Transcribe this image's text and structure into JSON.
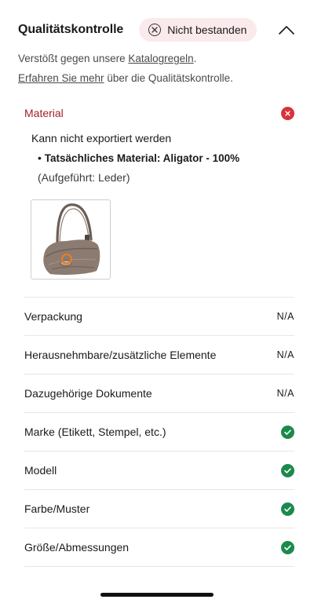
{
  "header": {
    "title": "Qualitätskontrolle",
    "status_label": "Nicht bestanden",
    "status_icon": "x-circle-icon",
    "collapse_icon": "chevron-up-icon"
  },
  "intro": {
    "line1_prefix": "Verstößt gegen unsere ",
    "catalog_link": "Katalogregeln",
    "line1_suffix": ".",
    "learn_more_link": "Erfahren Sie mehr",
    "line2_suffix": " über die Qualitätskontrolle."
  },
  "material": {
    "title": "Material",
    "status_icon": "error-icon",
    "message": "Kann nicht exportiert werden",
    "bullet": "• ",
    "actual": "Tatsächliches Material: Aligator - 100%",
    "listed": "(Aufgeführt: Leder)",
    "thumbnail": "handbag-photo"
  },
  "checks": [
    {
      "label": "Verpackung",
      "value": "N/A",
      "status": "na"
    },
    {
      "label": "Herausnehmbare/zusätzliche Elemente",
      "value": "N/A",
      "status": "na"
    },
    {
      "label": "Dazugehörige Dokumente",
      "value": "N/A",
      "status": "na"
    },
    {
      "label": "Marke (Etikett, Stempel, etc.)",
      "value": "",
      "status": "pass"
    },
    {
      "label": "Modell",
      "value": "",
      "status": "pass"
    },
    {
      "label": "Farbe/Muster",
      "value": "",
      "status": "pass"
    },
    {
      "label": "Größe/Abmessungen",
      "value": "",
      "status": "pass"
    }
  ],
  "colors": {
    "fail_red": "#d9323b",
    "material_title": "#a3202a",
    "pass_green": "#1b8a4c",
    "pill_background": "#fbeaec"
  }
}
